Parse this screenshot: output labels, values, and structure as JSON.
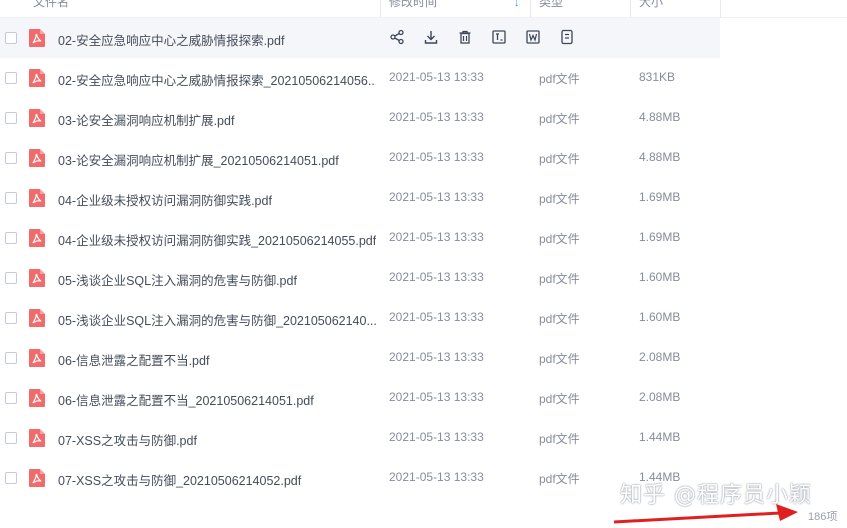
{
  "header": {
    "name_col": "文件名",
    "time_col": "修改时间",
    "type_col": "类型",
    "size_col": "大小"
  },
  "files": [
    {
      "name": "02-安全应急响应中心之威胁情报探索.pdf",
      "time": "",
      "type": "",
      "size": "",
      "hover": true
    },
    {
      "name": "02-安全应急响应中心之威胁情报探索_2021050621405​6...",
      "time": "2021-05-13 13:33",
      "type": "pdf文件",
      "size": "831KB"
    },
    {
      "name": "03-论安全漏洞响应机制扩展.pdf",
      "time": "2021-05-13 13:33",
      "type": "pdf文件",
      "size": "4.88MB"
    },
    {
      "name": "03-论安全漏洞响应机制扩展_20210506214051.pdf",
      "time": "2021-05-13 13:33",
      "type": "pdf文件",
      "size": "4.88MB"
    },
    {
      "name": "04-企业级未授权访问漏洞防御实践.pdf",
      "time": "2021-05-13 13:33",
      "type": "pdf文件",
      "size": "1.69MB"
    },
    {
      "name": "04-企业级未授权访问漏洞防御实践_20210506214055.pdf",
      "time": "2021-05-13 13:33",
      "type": "pdf文件",
      "size": "1.69MB"
    },
    {
      "name": "05-浅谈企业SQL注入漏洞的危害与防御.pdf",
      "time": "2021-05-13 13:33",
      "type": "pdf文件",
      "size": "1.60MB"
    },
    {
      "name": "05-浅谈企业SQL注入漏洞的危害与防御_20210506214​0...",
      "time": "2021-05-13 13:33",
      "type": "pdf文件",
      "size": "1.60MB"
    },
    {
      "name": "06-信息泄露之配置不当.pdf",
      "time": "2021-05-13 13:33",
      "type": "pdf文件",
      "size": "2.08MB"
    },
    {
      "name": "06-信息泄露之配置不当_20210506214051.pdf",
      "time": "2021-05-13 13:33",
      "type": "pdf文件",
      "size": "2.08MB"
    },
    {
      "name": "07-XSS之攻击与防御.pdf",
      "time": "2021-05-13 13:33",
      "type": "pdf文件",
      "size": "1.44MB"
    },
    {
      "name": "07-XSS之攻击与防御_20210506214052.pdf",
      "time": "2021-05-13 13:33",
      "type": "pdf文件",
      "size": "1.44MB"
    }
  ],
  "row_actions": [
    "share-icon",
    "download-icon",
    "delete-icon",
    "rename-icon",
    "word-icon",
    "more-icon"
  ],
  "footer": {
    "count": "186项",
    "watermark": "知乎 @程序员小颖"
  },
  "colors": {
    "pdf_icon": "#f06b6b",
    "sort_arrow": "#09aaff",
    "annotation_arrow": "#e02020"
  }
}
